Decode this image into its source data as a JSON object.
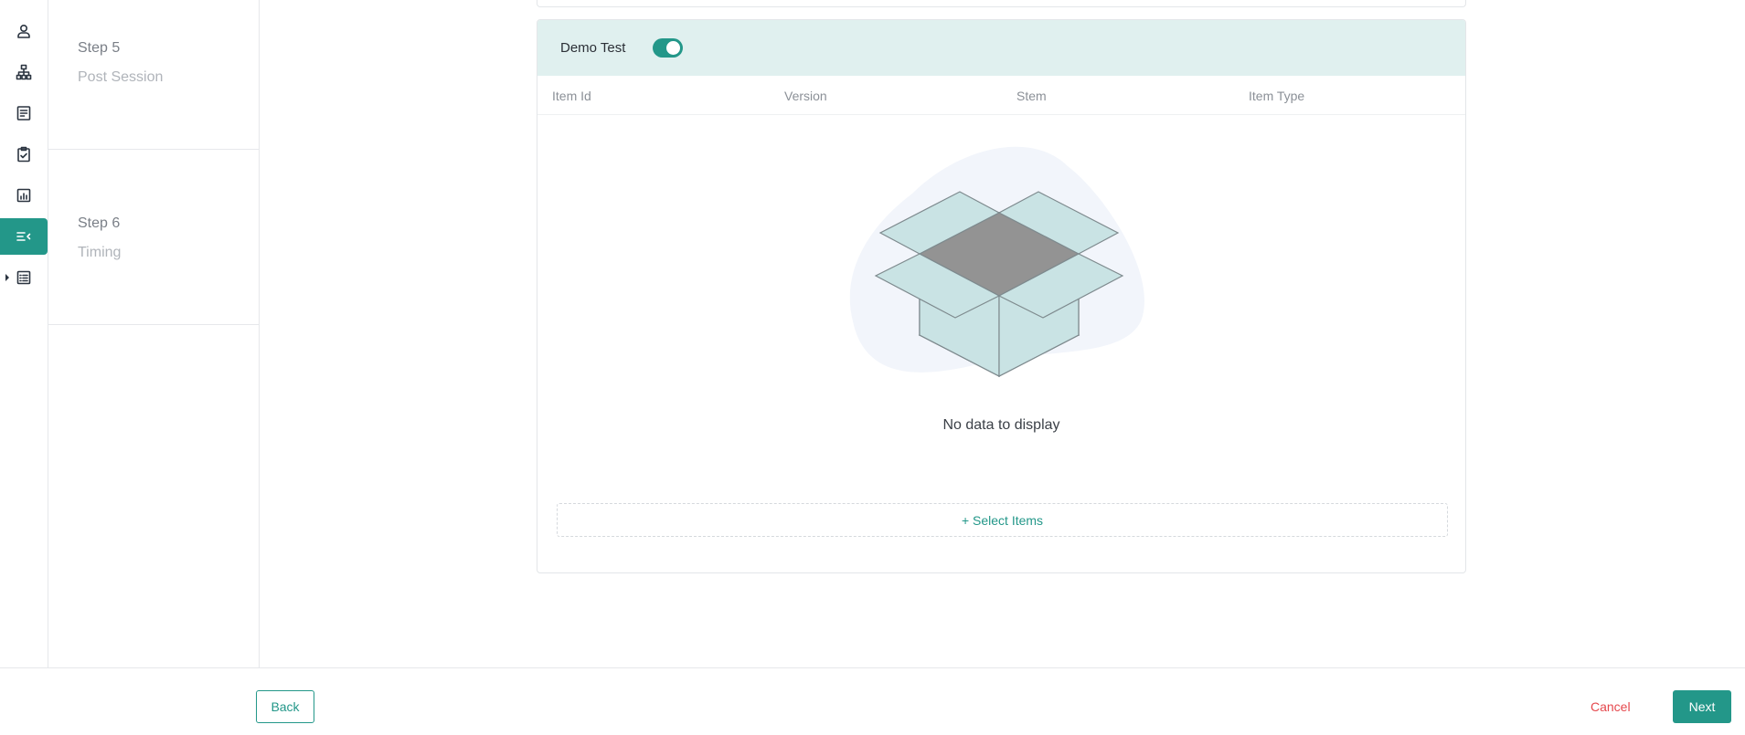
{
  "rail": {
    "items": [
      {
        "icon": "user-icon"
      },
      {
        "icon": "hierarchy-icon"
      },
      {
        "icon": "document-icon"
      },
      {
        "icon": "clipboard-check-icon"
      },
      {
        "icon": "bar-chart-icon"
      },
      {
        "icon": "align-left-icon",
        "active": true
      },
      {
        "icon": "list-table-icon"
      }
    ]
  },
  "steps": [
    {
      "number": "Step 5",
      "name": "Post Session"
    },
    {
      "number": "Step 6",
      "name": "Timing"
    }
  ],
  "panel": {
    "title": "Demo Test",
    "toggle_on": true,
    "columns": [
      "Item Id",
      "Version",
      "Stem",
      "Item Type"
    ],
    "empty_text": "No data to display",
    "select_items_label": "+ Select Items"
  },
  "footer": {
    "back_label": "Back",
    "cancel_label": "Cancel",
    "next_label": "Next"
  },
  "colors": {
    "accent": "#239789",
    "header_bg": "#e0f0ef",
    "danger": "#e5484d"
  }
}
